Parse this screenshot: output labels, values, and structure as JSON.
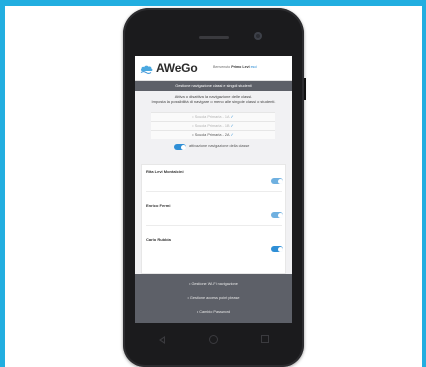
{
  "app": {
    "name": "AWeGo",
    "welcome_prefix": "Benvenuto",
    "user": "Primo Levi",
    "logout": "esci"
  },
  "section": {
    "title": "Gestione navigazione classi e singoli studenti"
  },
  "description": {
    "line1": "Attiva o disattiva la navigazione delle classi.",
    "line2": "Imposta la possibilità di navigare o meno alle singole classi o studenti."
  },
  "classes": [
    {
      "label": "Scuola Primaria - 1A",
      "selected": false
    },
    {
      "label": "Scuola Primaria - 1B",
      "selected": false
    },
    {
      "label": "Scuola Primaria - 2A",
      "selected": true
    }
  ],
  "activation": {
    "label": "attivazione navigazione della classe",
    "enabled": true
  },
  "students": [
    {
      "name": "Rita Levi Montalcini",
      "enabled": true
    },
    {
      "name": "Enrico Fermi",
      "enabled": true
    },
    {
      "name": "Carlo Rubbia",
      "enabled": true
    }
  ],
  "footer_menu": [
    {
      "label": "Gestione Wi-Fi navigazione"
    },
    {
      "label": "Gestione access point please"
    },
    {
      "label": "Cambio Password"
    }
  ],
  "colors": {
    "frame": "#22aee0",
    "accent": "#2f8fd6",
    "dark_bar": "#5d6068"
  },
  "icons": {
    "logo": "cloud-wave-icon",
    "check": "check-icon",
    "back": "back-triangle-icon",
    "home": "home-circle-icon",
    "recent": "recent-square-icon"
  }
}
